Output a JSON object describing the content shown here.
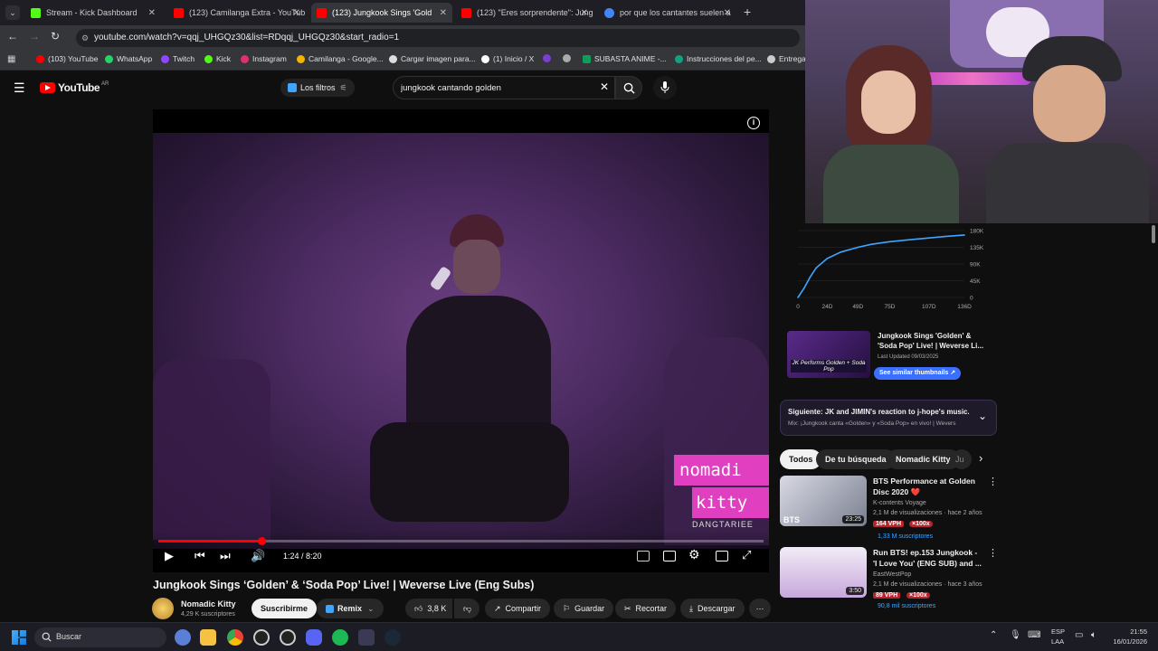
{
  "browser": {
    "tabs": [
      {
        "label": "Stream - Kick Dashboard",
        "color": "#53fc18"
      },
      {
        "label": "(123) Camilanga Extra - YouTub",
        "color": "#ff0000"
      },
      {
        "label": "(123) Jungkook Sings 'Gold",
        "color": "#ff0000"
      },
      {
        "label": "(123) \"Eres sorprendente\": Jung",
        "color": "#ff0000"
      },
      {
        "label": "por que los cantantes suelen a",
        "color": "#4285f4"
      }
    ],
    "url": "youtube.com/watch?v=qqj_UHGQz30&list=RDqqj_UHGQz30&start_radio=1",
    "bookmarks": [
      {
        "label": "(103) YouTube",
        "color": "#ff0000"
      },
      {
        "label": "WhatsApp",
        "color": "#25d366"
      },
      {
        "label": "Twitch",
        "color": "#9146ff"
      },
      {
        "label": "Kick",
        "color": "#53fc18"
      },
      {
        "label": "Instagram",
        "color": "#e1306c"
      },
      {
        "label": "Camilanga - Google...",
        "color": "#f4b400"
      },
      {
        "label": "Cargar imagen para...",
        "color": "#dddddd"
      },
      {
        "label": "(1) Inicio / X",
        "color": "#ffffff"
      },
      {
        "label": "SUBASTA ANIME -...",
        "color": "#0f9d58"
      },
      {
        "label": "Instrucciones del pe...",
        "color": "#10a37f"
      },
      {
        "label": "Entrega",
        "color": "#cccccc"
      }
    ]
  },
  "youtube": {
    "logo": "YouTube",
    "region": "AR",
    "filters_label": "Los filtros",
    "search_value": "jungkook cantando golden",
    "video": {
      "time": "1:24 / 8:20",
      "progress": 0.17,
      "overlay_text": [
        "nomadi",
        "kitty"
      ],
      "watermark": "DANGTARIEE"
    },
    "title": "Jungkook Sings ‘Golden’ & ‘Soda Pop’ Live! | Weverse Live (Eng Subs)",
    "channel": {
      "name": "Nomadic Kitty",
      "subs": "4,29 K suscriptores"
    },
    "actions": {
      "subscribe": "Suscribirme",
      "remix": "Remix",
      "likes": "3,8 K",
      "share": "Compartir",
      "save": "Guardar",
      "clip": "Recortar",
      "download": "Descargar"
    }
  },
  "sidebar": {
    "chart_data": {
      "type": "line",
      "x_ticks": [
        "0",
        "24D",
        "49D",
        "75D",
        "107D",
        "136D"
      ],
      "y_ticks": [
        "180K",
        "135K",
        "90K",
        "45K",
        "0"
      ],
      "x": [
        0,
        5,
        10,
        15,
        24,
        35,
        49,
        60,
        75,
        90,
        107,
        120,
        136
      ],
      "values": [
        0,
        25000,
        55000,
        80000,
        105000,
        122000,
        135000,
        143000,
        150000,
        155000,
        160000,
        164000,
        168000
      ],
      "ylim": [
        0,
        180000
      ],
      "color": "#3ea6ff"
    },
    "thumb_card": {
      "title": "Jungkook Sings 'Golden' & 'Soda Pop' Live! | Weverse Li...",
      "updated": "Last Updated 09/03/2025",
      "button": "See similar thumbnails",
      "thumb_caption": "JK Performs Golden + Soda Pop"
    },
    "next": {
      "title": "Siguiente: JK and JIMIN's reaction to j-hope's music...",
      "sub": "Mix: ¡Jungkook canta «Golden» y «Soda Pop» en vivo! | Wevers"
    },
    "chips": [
      "Todos",
      "De tu búsqueda",
      "Nomadic Kitty",
      "Ju"
    ],
    "recs": [
      {
        "title": "BTS Performance at Golden Disc 2020 ❤️",
        "channel": "K-contents Voyage",
        "meta": "2,1 M de visualizaciones · hace 2 años",
        "vph": "164 VPH",
        "badge": "×100x",
        "subs": "1,33 M suscriptores",
        "duration": "23:25",
        "thumb_label": "BTS"
      },
      {
        "title": "Run BTS! ep.153 Jungkook - 'I Love You' (ENG SUB) and ...",
        "channel": "EastWestPop",
        "meta": "2,1 M de visualizaciones · hace 3 años",
        "vph": "89 VPH",
        "badge": "×100x",
        "subs": "90,8 mil suscriptores",
        "duration": "3:50",
        "thumb_label": ""
      }
    ]
  },
  "taskbar": {
    "search": "Buscar",
    "lang": "ESP",
    "lang2": "LAA",
    "time": "21:55",
    "date": "16/01/2026"
  }
}
